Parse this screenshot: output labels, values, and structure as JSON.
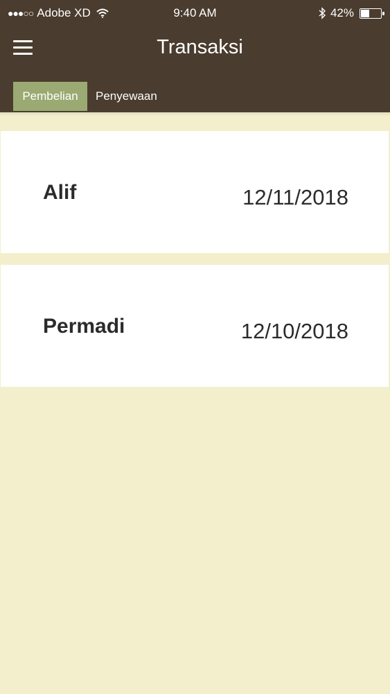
{
  "status_bar": {
    "signal": "●●●○○",
    "carrier": "Adobe XD",
    "time": "9:40 AM",
    "battery_percent": "42%",
    "battery_level": 0.42
  },
  "header": {
    "title": "Transaksi",
    "menu_icon": "hamburger-menu-icon"
  },
  "tabs": [
    {
      "label": "Pembelian",
      "active": true
    },
    {
      "label": "Penyewaan",
      "active": false
    }
  ],
  "transactions": [
    {
      "name": "Alif",
      "date": "12/11/2018"
    },
    {
      "name": "Permadi",
      "date": "12/10/2018"
    }
  ],
  "colors": {
    "header_bg": "#4a3c2e",
    "active_tab": "#9aaa72",
    "page_bg": "#f3efcc",
    "card_bg": "#ffffff"
  }
}
